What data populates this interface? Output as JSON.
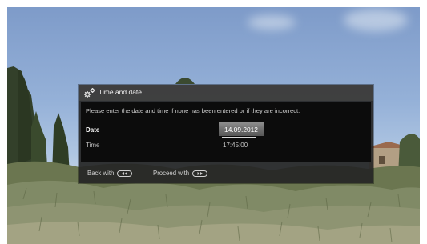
{
  "dialog": {
    "title": "Time and date",
    "instruction": "Please enter the date and time if none has been entered or if they are incorrect.",
    "fields": {
      "date_label": "Date",
      "date_value": "14.09.2012",
      "time_label": "Time",
      "time_value": "17:45:00"
    },
    "footer": {
      "back_label": "Back with",
      "proceed_label": "Proceed with"
    }
  },
  "icons": {
    "title_icon": "gears-icon",
    "back_key": "rewind-key-icon",
    "proceed_key": "fast-forward-key-icon"
  },
  "colors": {
    "dialog_bg": "#262626",
    "content_bg": "#0c0c0c",
    "selected_field": "#7a7a7a",
    "text": "#ffffff"
  }
}
